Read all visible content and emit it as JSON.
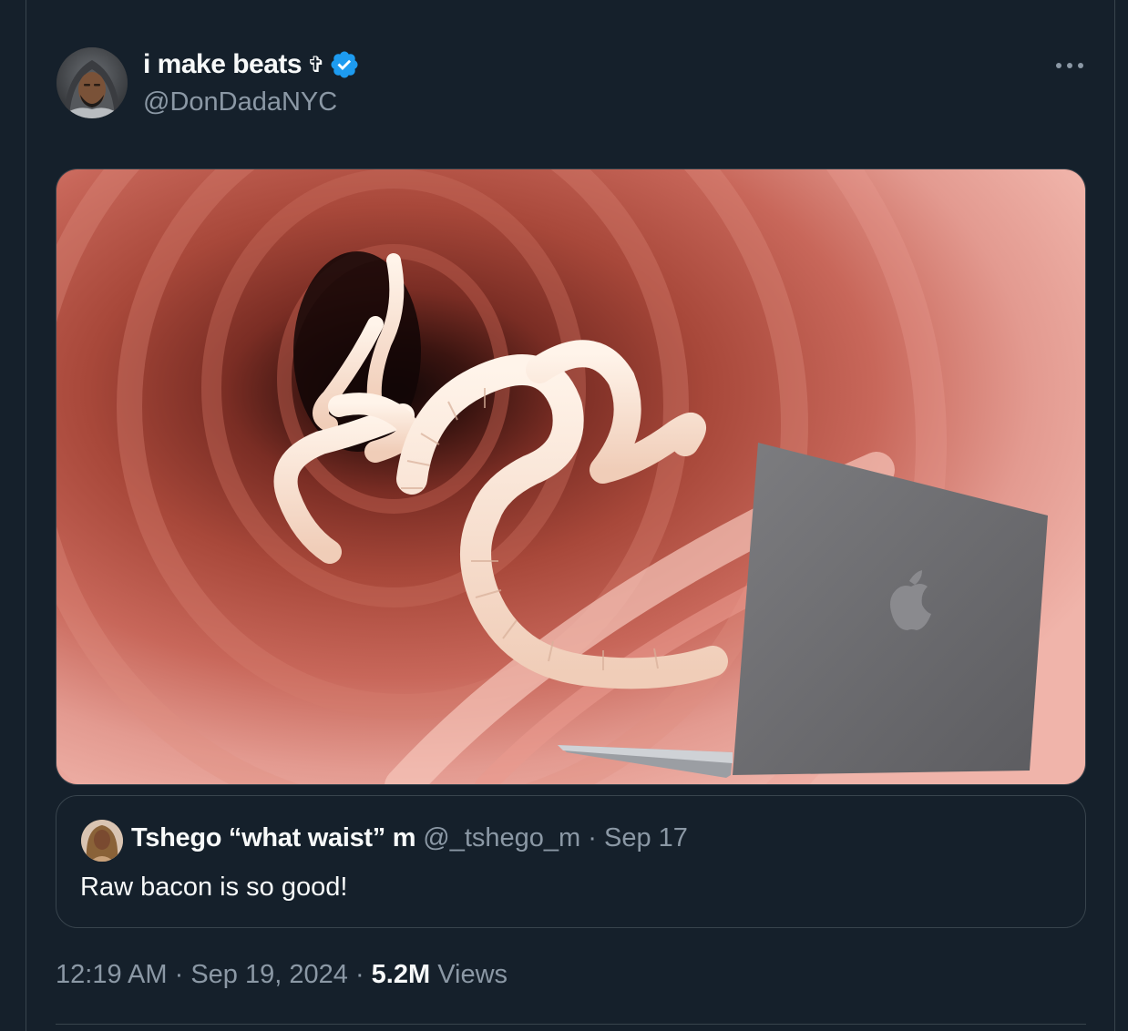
{
  "author": {
    "name": "i make beats",
    "name_glyph": "✞",
    "handle": "@DonDadaNYC",
    "verified": true,
    "avatar_icon": "avatar-hooded-man"
  },
  "more_icon": "more-horizontal-icon",
  "media": {
    "type": "image",
    "icons": [
      "tapeworm-in-intestine-image",
      "laptop-icon",
      "apple-logo-icon"
    ]
  },
  "quote": {
    "name": "Tshego “what waist” m",
    "handle": "@_tshego_m",
    "separator": "·",
    "date": "Sep 17",
    "text": "Raw bacon is so good!"
  },
  "meta": {
    "time": "12:19 AM",
    "separator": "·",
    "date": "Sep 19, 2024",
    "separator2": "·",
    "views_count": "5.2M",
    "views_label": "Views"
  },
  "colors": {
    "background": "#15202b",
    "border": "#38444d",
    "text_primary": "#f7f9f9",
    "text_secondary": "#8b98a5",
    "verified_blue": "#1d9bf0"
  }
}
